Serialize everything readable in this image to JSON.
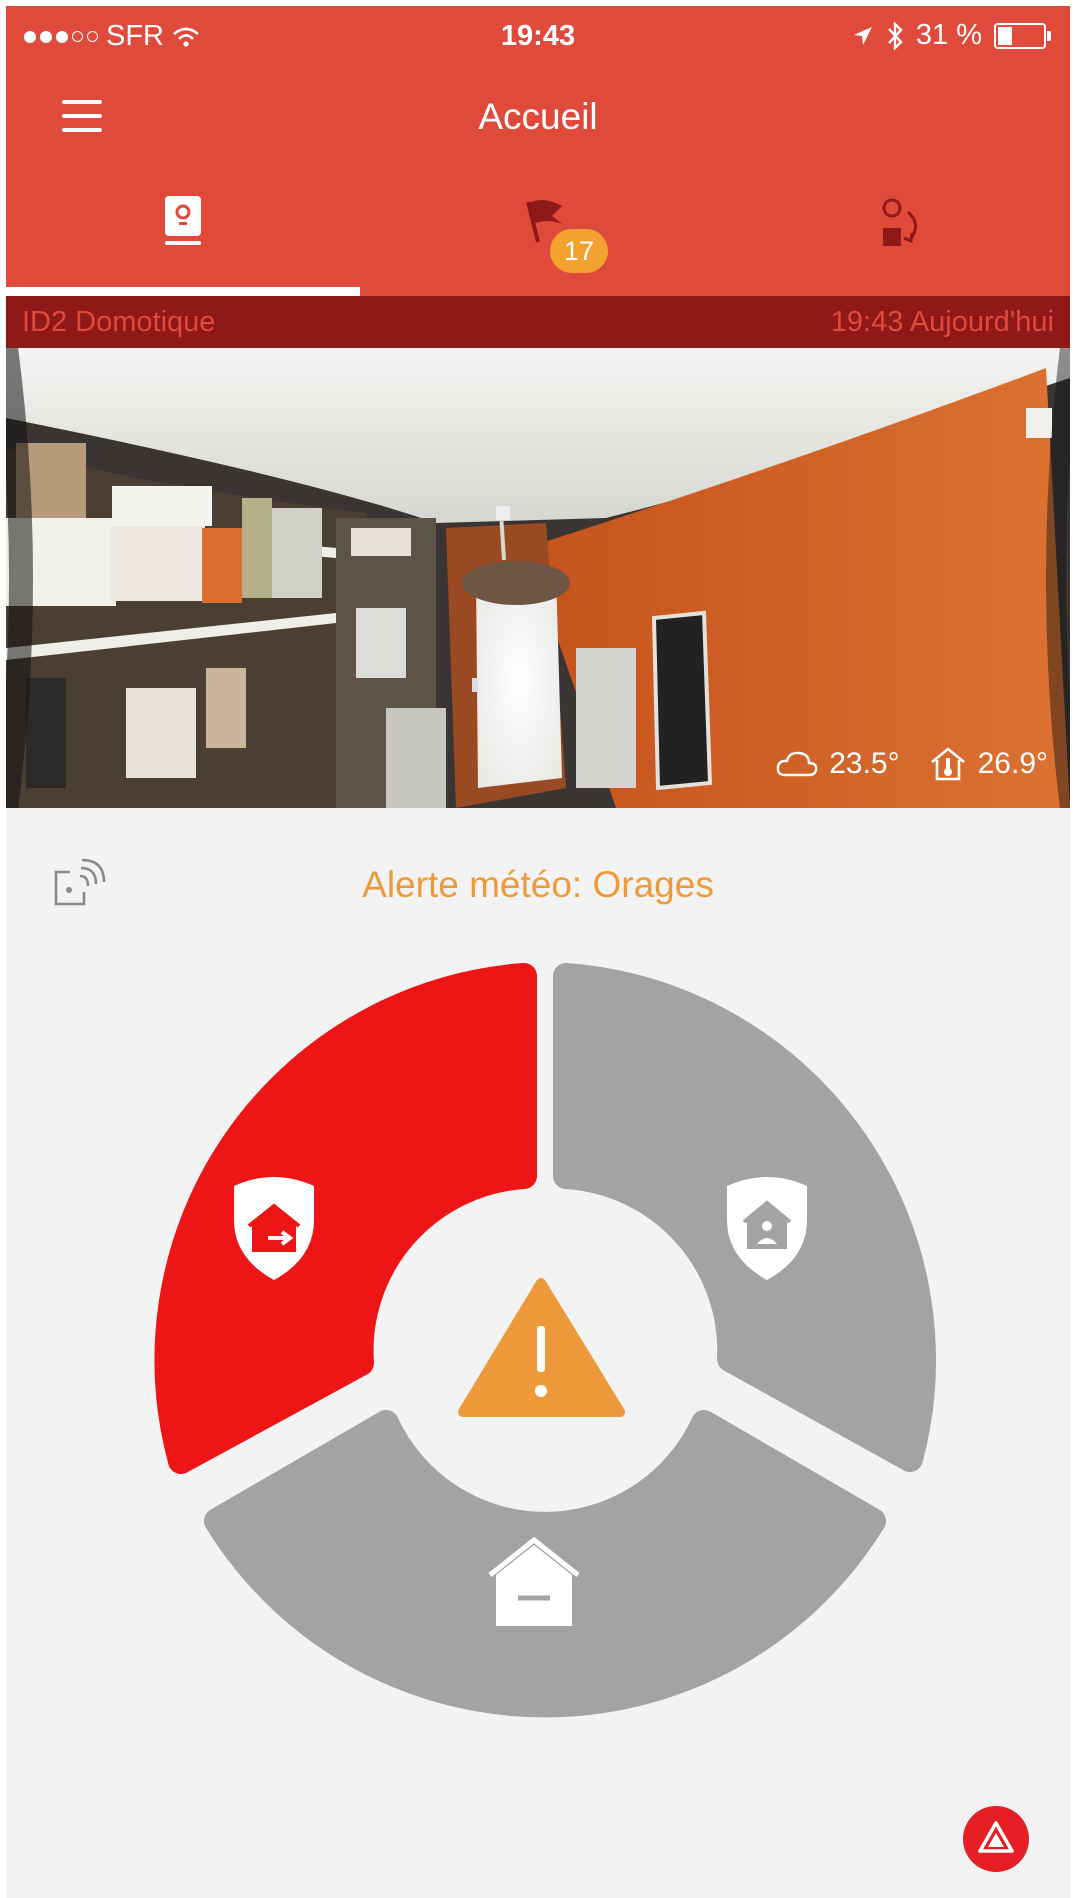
{
  "status_bar": {
    "carrier": "SFR",
    "time": "19:43",
    "battery": "31 %",
    "battery_level": 0.31
  },
  "header": {
    "title": "Accueil"
  },
  "tabs": [
    {
      "icon": "camera-device-icon",
      "selected": true
    },
    {
      "icon": "flag-icon",
      "badge": "17",
      "selected": false
    },
    {
      "icon": "scenario-swap-icon",
      "selected": false
    }
  ],
  "info_bar": {
    "device_name": "ID2 Domotique",
    "timestamp": "19:43 Aujourd'hui"
  },
  "camera": {
    "outdoor_temp": "23.5°",
    "indoor_temp": "26.9°"
  },
  "main": {
    "alert": "Alerte météo: Orages"
  },
  "modes": [
    {
      "name": "away-mode",
      "state": "active",
      "icon": "house-exit-shield-icon"
    },
    {
      "name": "presence-mode",
      "state": "inactive",
      "icon": "house-person-shield-icon"
    },
    {
      "name": "disarmed-mode",
      "state": "inactive",
      "icon": "house-minus-icon"
    }
  ],
  "colors": {
    "brand": "#e04a3b",
    "info_bar": "#8e1918",
    "active_mode": "#ed1515",
    "inactive_mode": "#a3a3a3",
    "warning": "#ef9a3a",
    "badge": "#f3a230",
    "sos": "#e61e25"
  }
}
